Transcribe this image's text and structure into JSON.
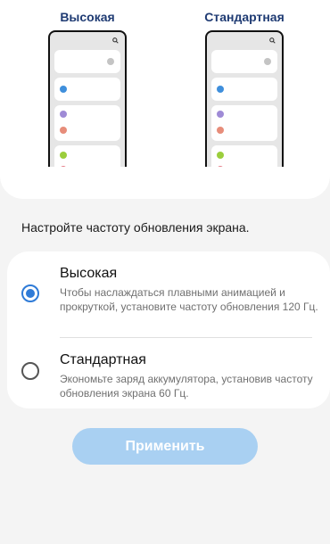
{
  "preview": {
    "high_label": "Высокая",
    "standard_label": "Стандартная",
    "dot_colors": {
      "gray": "#c4c4c4",
      "blue": "#3f8fdc",
      "purple": "#9f8bd6",
      "salmon": "#e78d7a",
      "green": "#9bce3c",
      "pink": "#e57b86"
    }
  },
  "instruction": "Настройте частоту обновления экрана.",
  "options": {
    "high": {
      "title": "Высокая",
      "description": "Чтобы наслаждаться плавными анимацией и прокруткой, установите частоту обновления 120 Гц.",
      "selected": true
    },
    "standard": {
      "title": "Стандартная",
      "description": "Экономьте заряд аккумулятора, установив частоту обновления экрана 60 Гц.",
      "selected": false
    }
  },
  "apply_button": {
    "label": "Применить",
    "enabled": false
  },
  "colors": {
    "accent": "#2f7bd7",
    "title_blue": "#1f3b73",
    "button_disabled": "#a9d0f2"
  }
}
